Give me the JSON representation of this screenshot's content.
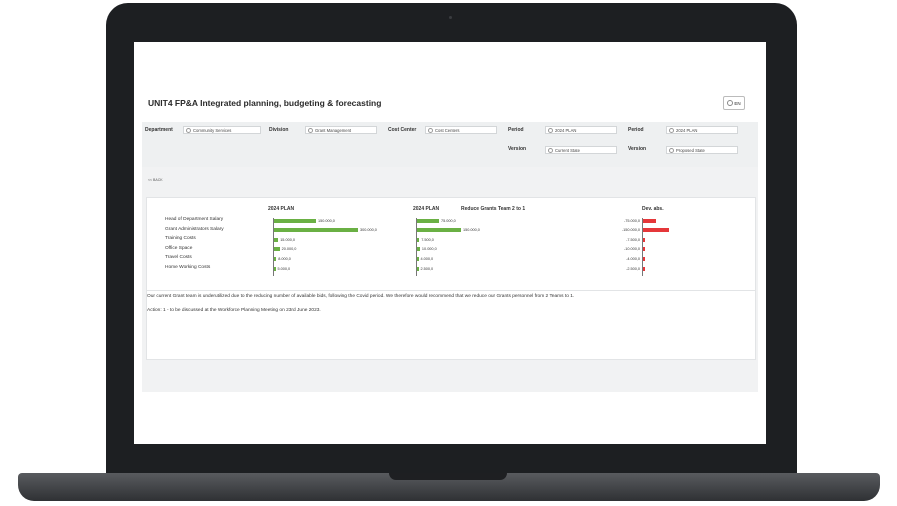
{
  "app": {
    "title": "UNIT4 FP&A Integrated planning, budgeting & forecasting",
    "language": "EN"
  },
  "filters": {
    "department": {
      "label": "Department",
      "value": "Community Services"
    },
    "division": {
      "label": "Division",
      "value": "Grant Management"
    },
    "cost_center": {
      "label": "Cost Center",
      "value": "Cost Centers"
    },
    "period_1": {
      "label": "Period",
      "value": "2024 PLAN"
    },
    "period_2": {
      "label": "Period",
      "value": "2024 PLAN"
    },
    "version_1": {
      "label": "Version",
      "value": "Current State"
    },
    "version_2": {
      "label": "Version",
      "value": "Proposed State"
    }
  },
  "nav": {
    "back_label": "<< BACK"
  },
  "chart_data": {
    "type": "bar",
    "categories": [
      "Head of Department Salary",
      "Grant Administrators Salary",
      "Training Costs",
      "Office Space",
      "Travel Costs",
      "Home Working Costs"
    ],
    "column_headers": [
      "2024 PLAN",
      "2024 PLAN",
      "Reduce Grants Team 2 to 1",
      "Dev. abs."
    ],
    "series": [
      {
        "values": [
          150000,
          300000,
          15000,
          20000,
          8000,
          5000
        ],
        "labels": [
          "150.000,0",
          "300.000,0",
          "15.000,0",
          "20.000,0",
          "8.000,0",
          "5.000,0"
        ]
      },
      {
        "values": [
          75000,
          150000,
          7500,
          10000,
          4000,
          2500
        ],
        "labels": [
          "75.000,0",
          "150.000,0",
          "7.500,0",
          "10.000,0",
          "4.000,0",
          "2.500,0"
        ]
      },
      {
        "values": [
          -75000,
          -150000,
          -7500,
          -10000,
          -4000,
          -2500
        ],
        "labels": [
          "-75.000,0",
          "-150.000,0",
          "-7.500,0",
          "-10.000,0",
          "-4.000,0",
          "-2.500,0"
        ]
      }
    ],
    "colors": {
      "positive": "#6ab044",
      "negative": "#e5373a"
    }
  },
  "comments": {
    "line1": "Our current Grant team is underutilized due to the reducing number of available bids, following the Covid period. We therefore would recommend that we reduce our Grants personnel from 2 Teams to 1.",
    "line2": "Action: 1 - to be discussed at the Workforce Planning Meeting on 23rd June 2023."
  }
}
